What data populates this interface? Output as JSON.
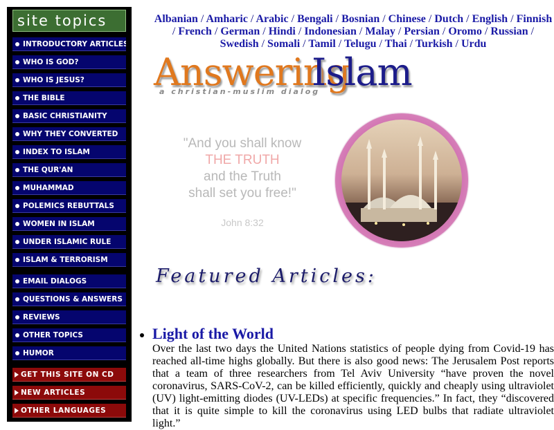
{
  "sidebar": {
    "header": "site topics",
    "items": [
      {
        "label": "INTRODUCTORY ARTICLES"
      },
      {
        "label": "WHO IS GOD?"
      },
      {
        "label": "WHO IS JESUS?"
      },
      {
        "label": "THE BIBLE"
      },
      {
        "label": "BASIC CHRISTIANITY"
      },
      {
        "label": "WHY THEY CONVERTED"
      },
      {
        "label": "INDEX TO ISLAM"
      },
      {
        "label": "THE QUR'AN"
      },
      {
        "label": "MUHAMMAD"
      },
      {
        "label": "POLEMICS REBUTTALS"
      },
      {
        "label": "WOMEN IN ISLAM"
      },
      {
        "label": "UNDER ISLAMIC RULE"
      },
      {
        "label": "ISLAM & TERRORISM"
      }
    ],
    "items2": [
      {
        "label": "EMAIL DIALOGS"
      },
      {
        "label": "QUESTIONS & ANSWERS"
      },
      {
        "label": "REVIEWS"
      },
      {
        "label": "OTHER TOPICS"
      },
      {
        "label": "HUMOR"
      }
    ],
    "red_items": [
      {
        "label": "GET THIS SITE ON CD"
      },
      {
        "label": "NEW ARTICLES"
      },
      {
        "label": "OTHER LANGUAGES"
      }
    ]
  },
  "languages": [
    "Albanian",
    "Amharic",
    "Arabic",
    "Bengali",
    "Bosnian",
    "Chinese",
    "Dutch",
    "English",
    "Finnish",
    "French",
    "German",
    "Hindi",
    "Indonesian",
    "Malay",
    "Persian",
    "Oromo",
    "Russian",
    "Swedish",
    "Somali",
    "Tamil",
    "Telugu",
    "Thai",
    "Turkish",
    "Urdu"
  ],
  "logo": {
    "word1": "Answering",
    "word2": "Islam",
    "tagline": "a christian-muslim dialog"
  },
  "quote": {
    "line1": "\"And you shall know",
    "line2": "THE TRUTH",
    "line3": "and the Truth",
    "line4": "shall set you free!\"",
    "reference": "John 8:32"
  },
  "featured_heading": "Featured Articles:",
  "article": {
    "title": "Light of the World",
    "body": "Over the last two days the United Nations statistics of people dying from Covid-19 has reached all-time highs globally. But there is also good news: The Jerusalem Post reports that a team of three researchers from Tel Aviv University “have proven the novel coronavirus, SARS-CoV-2, can be killed efficiently, quickly and cheaply using ultraviolet (UV) light-emitting diodes (UV-LEDs) at specific frequencies.” In fact, they “discovered that it is quite simple to kill the coronavirus using LED bulbs that radiate ultraviolet light.”"
  },
  "colors": {
    "nav_blue": "#05056e",
    "nav_red": "#8c0a0a",
    "link_blue": "#1a1aa6",
    "logo_orange": "#e0781e",
    "header_green": "#3c6e32"
  }
}
